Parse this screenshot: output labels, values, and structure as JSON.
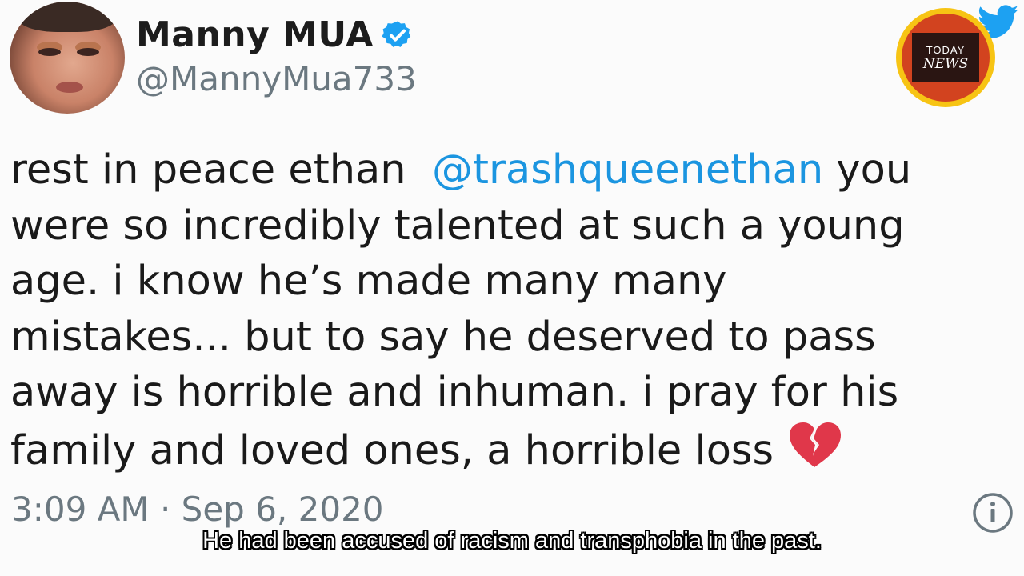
{
  "tweet": {
    "display_name": "Manny MUA",
    "handle": "@MannyMua733",
    "verified_icon": "verified-badge-icon",
    "text_before_mention": "rest in peace ethan  ",
    "mention": "@trashqueenethan",
    "text_after_mention": " you\nwere so incredibly talented at such a young\nage. i know he’s made many many\nmistakes... but to say he deserved to pass\naway is horrible and inhuman. i pray for his\nfamily and loved ones, a horrible loss ",
    "emoji": "broken-heart-icon",
    "timestamp": "3:09 AM · Sep 6, 2020",
    "info_icon": "info-icon"
  },
  "overlay": {
    "logo_line1": "TODAY",
    "logo_line2": "NEWS",
    "bird_icon": "twitter-bird-icon",
    "subtitle": "He had been accused of racism and transphobia in the past."
  },
  "colors": {
    "mention": "#1b95e0",
    "verified": "#1da1f2",
    "muted": "#6b7880",
    "badge_ring": "#f7c414",
    "badge_fill": "#d2431f"
  }
}
